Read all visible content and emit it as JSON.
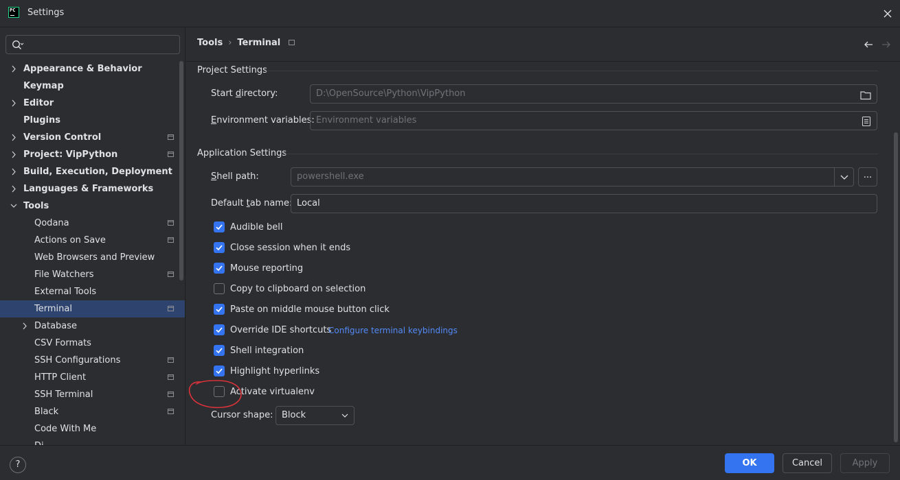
{
  "window": {
    "app_icon_text": "PC",
    "title": "Settings"
  },
  "sidebar": {
    "search": {
      "placeholder": ""
    },
    "items": [
      {
        "label": "Appearance & Behavior",
        "bold": true,
        "expandable": true,
        "expanded": false,
        "project": false
      },
      {
        "label": "Keymap",
        "bold": true,
        "expandable": false,
        "project": false
      },
      {
        "label": "Editor",
        "bold": true,
        "expandable": true,
        "expanded": false,
        "project": false
      },
      {
        "label": "Plugins",
        "bold": true,
        "expandable": false,
        "project": false
      },
      {
        "label": "Version Control",
        "bold": true,
        "expandable": true,
        "expanded": false,
        "project": true
      },
      {
        "label": "Project: VipPython",
        "bold": true,
        "expandable": true,
        "expanded": false,
        "project": true
      },
      {
        "label": "Build, Execution, Deployment",
        "bold": true,
        "expandable": true,
        "expanded": false,
        "project": false
      },
      {
        "label": "Languages & Frameworks",
        "bold": true,
        "expandable": true,
        "expanded": false,
        "project": false
      },
      {
        "label": "Tools",
        "bold": true,
        "expandable": true,
        "expanded": true,
        "project": false
      },
      {
        "label": "Qodana",
        "bold": false,
        "child": true,
        "project": true
      },
      {
        "label": "Actions on Save",
        "bold": false,
        "child": true,
        "project": true
      },
      {
        "label": "Web Browsers and Preview",
        "bold": false,
        "child": true,
        "project": false
      },
      {
        "label": "File Watchers",
        "bold": false,
        "child": true,
        "project": true
      },
      {
        "label": "External Tools",
        "bold": false,
        "child": true,
        "project": false
      },
      {
        "label": "Terminal",
        "bold": false,
        "child": true,
        "project": true,
        "selected": true
      },
      {
        "label": "Database",
        "bold": false,
        "child": true,
        "expandable": true,
        "expanded": false,
        "project": false
      },
      {
        "label": "CSV Formats",
        "bold": false,
        "child": true,
        "project": false
      },
      {
        "label": "SSH Configurations",
        "bold": false,
        "child": true,
        "project": true
      },
      {
        "label": "HTTP Client",
        "bold": false,
        "child": true,
        "project": true
      },
      {
        "label": "SSH Terminal",
        "bold": false,
        "child": true,
        "project": true
      },
      {
        "label": "Black",
        "bold": false,
        "child": true,
        "project": true
      },
      {
        "label": "Code With Me",
        "bold": false,
        "child": true,
        "project": false
      },
      {
        "label": "Di...",
        "bold": false,
        "child": true,
        "project": false
      }
    ]
  },
  "breadcrumb": {
    "parent": "Tools",
    "separator": "›",
    "current": "Terminal"
  },
  "project_settings": {
    "title": "Project Settings",
    "start_directory": {
      "label_pre": "Start ",
      "label_mnemonic": "d",
      "label_post": "irectory:",
      "value": "D:\\OpenSource\\Python\\VipPython"
    },
    "env_vars": {
      "label_pre": "",
      "label_mnemonic": "E",
      "label_post": "nvironment variables:",
      "placeholder": "Environment variables"
    }
  },
  "app_settings": {
    "title": "Application Settings",
    "shell_path": {
      "label_pre": "",
      "label_mnemonic": "S",
      "label_post": "hell path:",
      "value": "powershell.exe",
      "browse_label": "..."
    },
    "tab_name": {
      "label_pre": "Default ",
      "label_mnemonic": "t",
      "label_post": "ab name:",
      "value": "Local"
    },
    "checkboxes": [
      {
        "label": "Audible bell",
        "checked": true
      },
      {
        "label": "Close session when it ends",
        "checked": true
      },
      {
        "label": "Mouse reporting",
        "checked": true
      },
      {
        "label": "Copy to clipboard on selection",
        "checked": false
      },
      {
        "label": "Paste on middle mouse button click",
        "checked": true
      },
      {
        "label": "Override IDE shortcuts",
        "checked": true,
        "link": "Configure terminal keybindings"
      },
      {
        "label": "Shell integration",
        "checked": true
      },
      {
        "label": "Highlight hyperlinks",
        "checked": true
      },
      {
        "label": "Activate virtualenv",
        "checked": false
      }
    ],
    "cursor_shape": {
      "label": "Cursor shape:",
      "value": "Block"
    }
  },
  "footer": {
    "help_label": "?",
    "ok_label": "OK",
    "cancel_label": "Cancel",
    "apply_label": "Apply"
  },
  "colors": {
    "accent": "#3574f0",
    "link": "#548af7",
    "selection": "#2e436e",
    "annotation": "#d9323a"
  }
}
